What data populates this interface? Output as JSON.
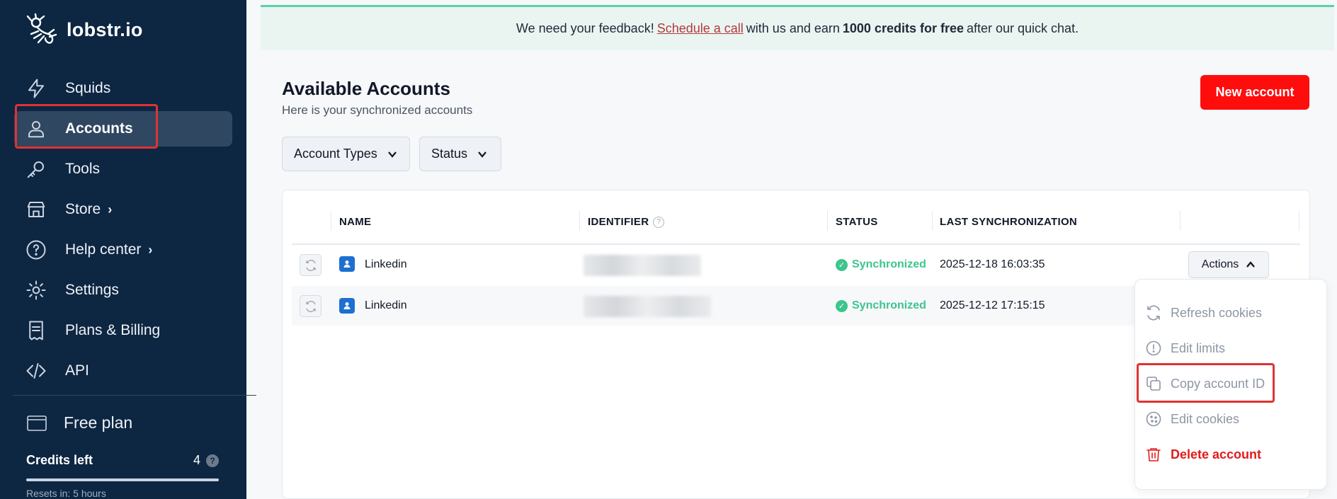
{
  "app": {
    "logo_text": "lobstr.io"
  },
  "sidebar": {
    "items": [
      {
        "label": "Squids",
        "icon": "lightning-icon"
      },
      {
        "label": "Accounts",
        "icon": "user-icon"
      },
      {
        "label": "Tools",
        "icon": "key-icon"
      },
      {
        "label": "Store",
        "icon": "store-icon",
        "chevron": "›"
      },
      {
        "label": "Help center",
        "icon": "help-icon",
        "chevron": "›"
      },
      {
        "label": "Settings",
        "icon": "gear-icon"
      },
      {
        "label": "Plans & Billing",
        "icon": "receipt-icon"
      },
      {
        "label": "API",
        "icon": "code-icon"
      }
    ],
    "active_item": "Accounts",
    "plan": "Free plan",
    "credits_label": "Credits left",
    "credits_value": "4",
    "credits_help": "?",
    "credits_fraction": 1.0,
    "resets": "Resets in: 5 hours"
  },
  "banner": {
    "prefix": "We need your feedback!",
    "link": "Schedule a call",
    "middle": "with us and earn",
    "bold": "1000 credits for free",
    "suffix": "after our quick chat."
  },
  "page": {
    "title": "Available Accounts",
    "subtitle": "Here is your synchronized accounts",
    "new_button": "New account"
  },
  "filters": {
    "types": "Account Types",
    "status": "Status"
  },
  "table": {
    "headers": {
      "name": "NAME",
      "identifier": "IDENTIFIER",
      "identifier_help": "?",
      "status": "STATUS",
      "last_sync": "LAST SYNCHRONIZATION"
    },
    "rows": [
      {
        "name": "Linkedin",
        "status": "Synchronized",
        "last_sync": "2025-12-18 16:03:35"
      },
      {
        "name": "Linkedin",
        "status": "Synchronized",
        "last_sync": "2025-12-12 17:15:15"
      }
    ],
    "actions_label": "Actions"
  },
  "menu": {
    "items": [
      {
        "label": "Refresh cookies",
        "icon": "refresh-icon"
      },
      {
        "label": "Edit limits",
        "icon": "alert-circle-icon"
      },
      {
        "label": "Copy account ID",
        "icon": "copy-icon"
      },
      {
        "label": "Edit cookies",
        "icon": "cookie-icon"
      },
      {
        "label": "Delete account",
        "icon": "trash-icon"
      }
    ]
  },
  "colors": {
    "sidebar_bg": "#0d2642",
    "accent_red": "#ff0d0d",
    "success": "#3cc58e",
    "banner_bg": "#eaf5f2"
  }
}
